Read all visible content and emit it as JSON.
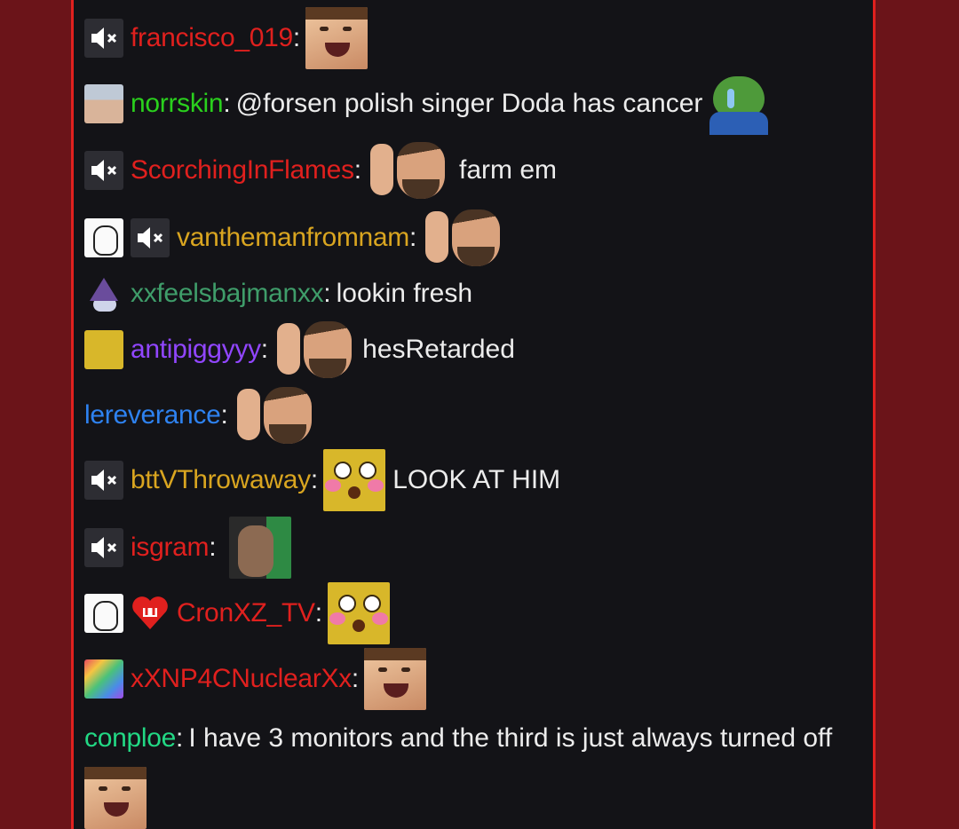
{
  "colors": {
    "frame_bg": "#6b1419",
    "chat_bg": "#131317",
    "border": "#e0201e",
    "text": "#ececec"
  },
  "messages": [
    {
      "id": "m1",
      "user": "francisco_019",
      "color": "#e0201e",
      "badges": [
        "mute-icon"
      ],
      "text": "",
      "emotes": [
        "forsen-laugh-emote"
      ]
    },
    {
      "id": "m2",
      "user": "norrskin",
      "color": "#2ad01d",
      "badges": [
        "avatar-glasses"
      ],
      "text": "@forsen  polish singer Doda has cancer",
      "emotes": [
        "pepe-hands-emote"
      ]
    },
    {
      "id": "m3",
      "user": "ScorchingInFlames",
      "color": "#e0201e",
      "badges": [
        "mute-icon"
      ],
      "text": "farm em",
      "emotes": [
        "forsen-point-emote"
      ]
    },
    {
      "id": "m4",
      "user": "vanthemanfromnam",
      "color": "#d9a520",
      "badges": [
        "avatar-doodle",
        "mute-icon"
      ],
      "text": "",
      "emotes": [
        "forsen-point-emote"
      ]
    },
    {
      "id": "m5",
      "user": "xxfeelsbajmanxx",
      "color": "#3f9d6a",
      "badges": [
        "avatar-wizard"
      ],
      "text": "lookin fresh",
      "emotes": []
    },
    {
      "id": "m6",
      "user": "antipiggyyy",
      "color": "#9146ff",
      "badges": [
        "avatar-yellow"
      ],
      "text": "hesRetarded",
      "emotes": [
        "forsen-point-emote"
      ]
    },
    {
      "id": "m7",
      "user": "lereverance",
      "color": "#2e82f0",
      "badges": [],
      "text": "",
      "emotes": [
        "forsen-point-emote"
      ]
    },
    {
      "id": "m8",
      "user": "bttVThrowaway",
      "color": "#d9a520",
      "badges": [
        "mute-icon"
      ],
      "text": "LOOK AT HIM",
      "emotes": [
        "blush-face-emote"
      ]
    },
    {
      "id": "m9",
      "user": "isgram",
      "color": "#e0201e",
      "badges": [
        "mute-icon"
      ],
      "text": "",
      "emotes": [
        "bearded-man-emote"
      ]
    },
    {
      "id": "m10",
      "user": "CronXZ_TV",
      "color": "#e0201e",
      "badges": [
        "avatar-doodle",
        "heart-badge"
      ],
      "text": "",
      "emotes": [
        "blush-face-emote"
      ]
    },
    {
      "id": "m11",
      "user": "xXNP4CNuclearXx",
      "color": "#e0201e",
      "badges": [
        "avatar-rainbow"
      ],
      "text": "",
      "emotes": [
        "forsen-laugh-emote"
      ]
    },
    {
      "id": "m13",
      "user": "conploe",
      "color": "#22d884",
      "badges": [],
      "text": "I have 3 monitors and the third is just always turned off",
      "emotes": [
        "forsen-laugh-emote"
      ]
    }
  ]
}
